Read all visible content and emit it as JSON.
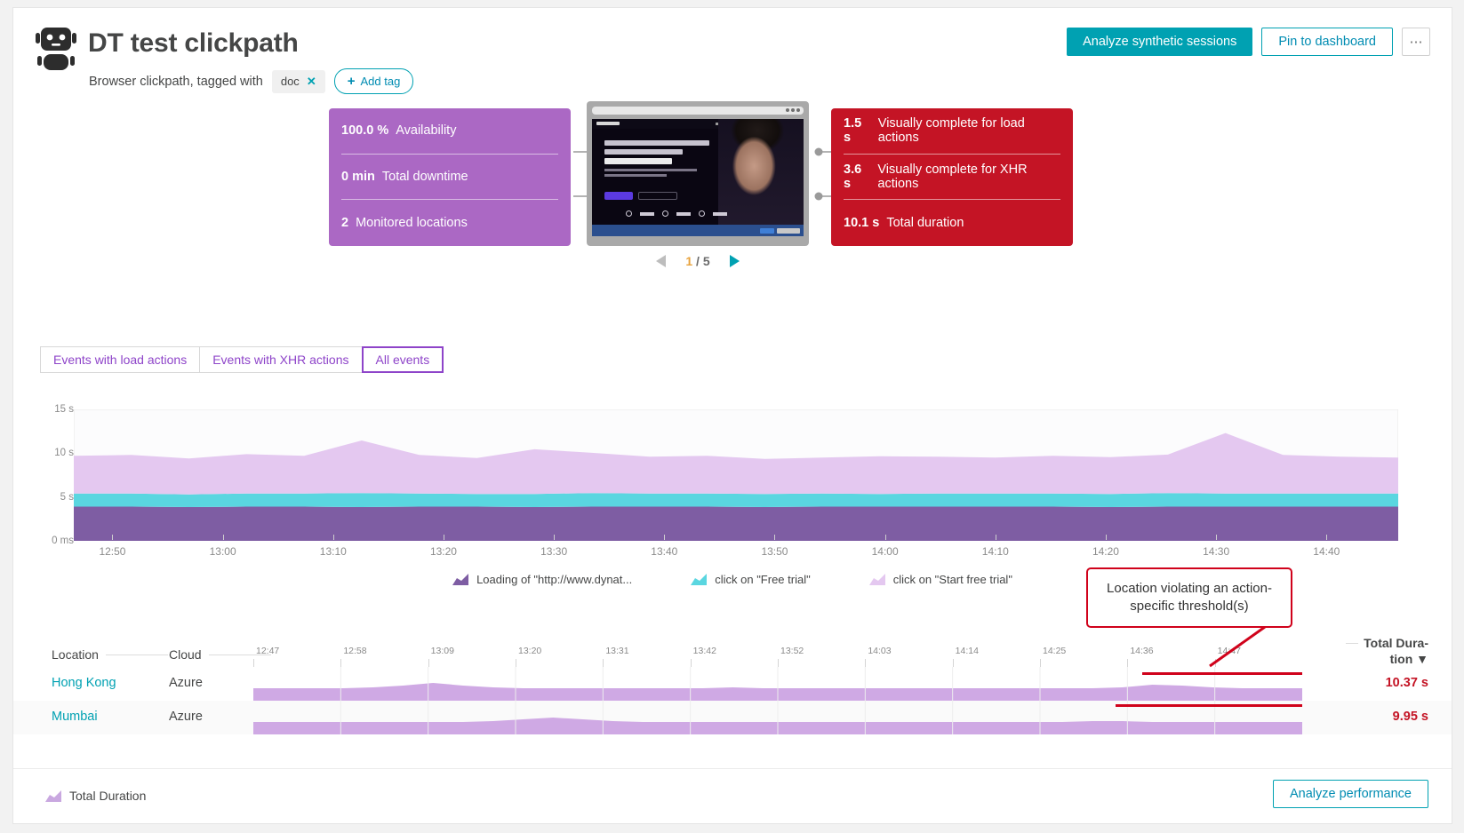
{
  "header": {
    "title": "DT test clickpath",
    "subtitle": "Browser clickpath, tagged with",
    "tag": "doc",
    "tag_remove": "✕",
    "add_tag": "Add tag",
    "add_tag_plus": "+",
    "analyze_sessions": "Analyze synthetic sessions",
    "pin_dashboard": "Pin to dashboard",
    "more": "⋯"
  },
  "summary": {
    "left_tile": {
      "color": "#ab68c4",
      "rows": [
        {
          "value": "100.0 %",
          "label": "Availability"
        },
        {
          "value": "0 min",
          "label": "Total downtime"
        },
        {
          "value": "2",
          "label": "Monitored locations"
        }
      ]
    },
    "right_tile": {
      "color": "#c41425",
      "rows": [
        {
          "value": "1.5 s",
          "label": "Visually complete for load actions"
        },
        {
          "value": "3.6 s",
          "label": "Visually complete for XHR actions"
        },
        {
          "value": "10.1 s",
          "label": "Total duration"
        }
      ]
    },
    "screenshot": {
      "hero_line1": "\"Managing complexity in the",
      "hero_line2": "enterprise cloud? Easy.",
      "hero_line3": "Only Dynatrace.\""
    },
    "pager": {
      "current": "1",
      "separator": "/",
      "total": "5"
    }
  },
  "tabs": [
    {
      "label": "Events with load actions",
      "active": false
    },
    {
      "label": "Events with XHR actions",
      "active": false
    },
    {
      "label": "All events",
      "active": true
    }
  ],
  "chart_data": {
    "type": "area",
    "title": "",
    "xlabel": "",
    "ylabel": "",
    "stacked": true,
    "grid": false,
    "legend_position": "bottom",
    "ylim": [
      0,
      15
    ],
    "ytick_labels": [
      "0 ms",
      "5 s",
      "10 s",
      "15 s"
    ],
    "ytick_values": [
      0,
      5,
      10,
      15
    ],
    "xtick_labels": [
      "12:50",
      "13:00",
      "13:10",
      "13:20",
      "13:30",
      "13:40",
      "13:50",
      "14:00",
      "14:10",
      "14:20",
      "14:30",
      "14:40"
    ],
    "x": [
      12.83,
      12.92,
      13.0,
      13.08,
      13.17,
      13.25,
      13.33,
      13.42,
      13.5,
      13.58,
      13.67,
      13.75,
      13.83,
      13.92,
      14.0,
      14.08,
      14.17,
      14.25,
      14.33,
      14.42,
      14.5,
      14.58,
      14.67,
      14.75
    ],
    "series": [
      {
        "name": "Loading of \"http://www.dynat...",
        "color": "#7e5da3",
        "values": [
          3.9,
          3.9,
          3.85,
          3.9,
          3.9,
          3.85,
          3.9,
          3.9,
          3.85,
          3.9,
          3.9,
          3.9,
          3.85,
          3.9,
          3.9,
          3.9,
          3.9,
          3.9,
          3.85,
          3.9,
          3.9,
          3.9,
          3.9,
          3.9
        ]
      },
      {
        "name": "click on \"Free trial\"",
        "color": "#5ad6e0",
        "values": [
          1.5,
          1.5,
          1.45,
          1.5,
          1.5,
          1.6,
          1.5,
          1.45,
          1.5,
          1.55,
          1.5,
          1.5,
          1.5,
          1.5,
          1.45,
          1.5,
          1.5,
          1.5,
          1.5,
          1.55,
          1.5,
          1.5,
          1.5,
          1.5
        ]
      },
      {
        "name": "click on \"Start free trial\"",
        "color": "#e4c8f0",
        "values": [
          4.3,
          4.4,
          4.1,
          4.5,
          4.3,
          6.0,
          4.4,
          4.1,
          5.1,
          4.6,
          4.2,
          4.3,
          4.0,
          4.1,
          4.3,
          4.2,
          4.1,
          4.3,
          4.2,
          4.4,
          6.9,
          4.4,
          4.2,
          4.1
        ]
      }
    ]
  },
  "location_table": {
    "headers": {
      "location": "Location",
      "cloud": "Cloud",
      "total": "Total Dura-",
      "total2": "tion ▼",
      "sort_arrow": "▼"
    },
    "timestamps": [
      "12:47",
      "12:58",
      "13:09",
      "13:20",
      "13:31",
      "13:42",
      "13:52",
      "14:03",
      "14:14",
      "14:25",
      "14:36",
      "14:47"
    ],
    "rows": [
      {
        "location": "Hong Kong",
        "cloud": "Azure",
        "total": "10.37 s",
        "violating": true
      },
      {
        "location": "Mumbai",
        "cloud": "Azure",
        "total": "9.95 s",
        "violating": true
      }
    ]
  },
  "callout": {
    "line1": "Location violating an action-",
    "line2": "specific threshold(s)"
  },
  "footer": {
    "legend": "Total Duration",
    "analyze": "Analyze performance"
  },
  "colors": {
    "accent": "#00a1b2",
    "purple": "#8e44c9",
    "red": "#c41425",
    "tile_purple": "#ab68c4"
  }
}
